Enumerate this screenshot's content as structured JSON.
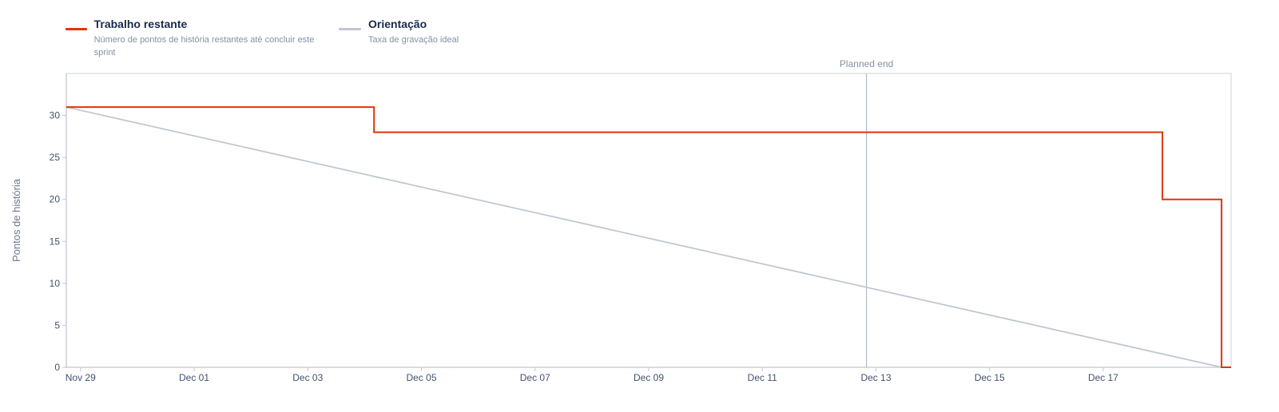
{
  "legend": {
    "items": [
      {
        "title": "Trabalho restante",
        "desc": "Número de pontos de história restantes até concluir este sprint",
        "color": "#de350b"
      },
      {
        "title": "Orientação",
        "desc": "Taxa de gravação ideal",
        "color": "#c1c7d0"
      }
    ]
  },
  "chart_data": {
    "type": "line",
    "ylabel": "Pontos de história",
    "xlabel": "",
    "ylim": [
      0,
      35
    ],
    "yticks": [
      0,
      5,
      10,
      15,
      20,
      25,
      30
    ],
    "xlim": [
      "2023-11-28T18:00",
      "2023-12-19T06:00"
    ],
    "xticks": [
      "Nov 29",
      "Dec 01",
      "Dec 03",
      "Dec 05",
      "Dec 07",
      "Dec 09",
      "Dec 11",
      "Dec 13",
      "Dec 15",
      "Dec 17"
    ],
    "xtick_dates": [
      "2023-11-29T00:00",
      "2023-12-01T00:00",
      "2023-12-03T00:00",
      "2023-12-05T00:00",
      "2023-12-07T00:00",
      "2023-12-09T00:00",
      "2023-12-11T00:00",
      "2023-12-13T00:00",
      "2023-12-15T00:00",
      "2023-12-17T00:00"
    ],
    "grid": false,
    "legend_position": "top-left",
    "series": [
      {
        "name": "Trabalho restante",
        "style": "step",
        "color": "#de350b",
        "points": [
          [
            "2023-11-28T18:00",
            31
          ],
          [
            "2023-12-04T04:00",
            31
          ],
          [
            "2023-12-04T04:00",
            28
          ],
          [
            "2023-12-18T01:00",
            28
          ],
          [
            "2023-12-18T01:00",
            20
          ],
          [
            "2023-12-19T02:00",
            20
          ],
          [
            "2023-12-19T02:00",
            0
          ],
          [
            "2023-12-19T06:00",
            0
          ]
        ]
      },
      {
        "name": "Orientação",
        "style": "line",
        "color": "#c1c7d0",
        "points": [
          [
            "2023-11-28T18:00",
            31
          ],
          [
            "2023-12-19T02:00",
            0
          ]
        ]
      }
    ],
    "annotations": [
      {
        "label": "Planned end",
        "x": "2023-12-12T20:00"
      }
    ]
  }
}
